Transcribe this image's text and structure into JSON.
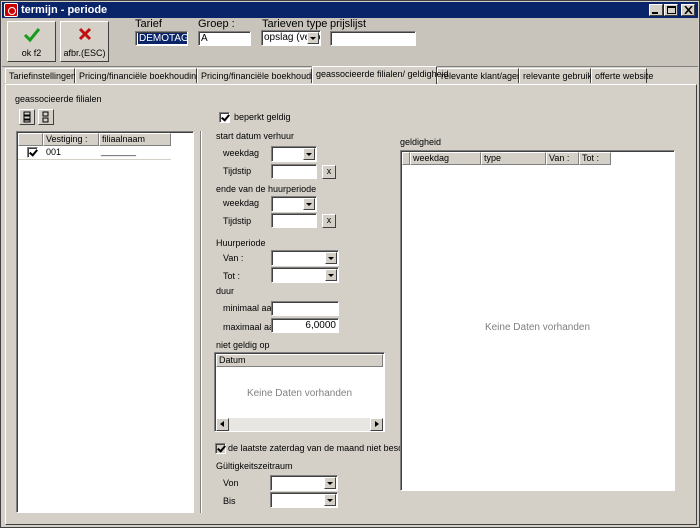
{
  "window": {
    "title": "termijn - periode"
  },
  "toolbar": {
    "ok_label": "ok f2",
    "cancel_label": "afbr.(ESC)"
  },
  "header": {
    "tarief_label": "Tarief",
    "tarief_value": "DEMOTAG",
    "groep_label": "Groep :",
    "groep_value": "A",
    "tarieven_type_label": "Tarieven type",
    "tarieven_type_value": "opslag (verko",
    "prijslijst_label": "prijslijst",
    "prijslijst_value": ""
  },
  "tabs": [
    {
      "label": "Tariefinstellingen"
    },
    {
      "label": "Pricing/financiële boekhouding I"
    },
    {
      "label": "Pricing/financiële boekhouding II"
    },
    {
      "label": "geassocieerde filialen/ geldigheid"
    },
    {
      "label": "relevante klant/agent"
    },
    {
      "label": "relevante gebruiker"
    },
    {
      "label": "offerte website"
    }
  ],
  "filialen": {
    "title": "geassocieerde filialen",
    "columns": [
      "Vestiging :",
      "filiaalnaam"
    ],
    "rows": [
      {
        "vestiging": "001",
        "naam": "_______"
      }
    ]
  },
  "form": {
    "beperkt_geldig": "beperkt geldig",
    "start_section": "start datum verhuur",
    "weekdag": "weekdag",
    "tijdstip": "Tijdstip",
    "x_label": "x",
    "ende_section": "ende van de huurperiode",
    "huurperiode": "Huurperiode",
    "van": "Van :",
    "tot": "Tot :",
    "duur": "duur",
    "minimaal": "minimaal aanta",
    "maximaal": "maximaal aant",
    "maximaal_value": "6,0000",
    "niet_geldig_op": "niet geldig op",
    "datum_col": "Datum",
    "no_data": "Keine Daten vorhanden",
    "laatste_zaterdag": "de laatste zaterdag van de maand niet beschik",
    "gueltigkeitszeitraum": "Gültigkeitszeitraum",
    "von": "Von",
    "bis": "Bis"
  },
  "geldigheid": {
    "title": "geldigheid",
    "columns": [
      "weekdag",
      "type",
      "Van :",
      "Tot :"
    ],
    "no_data": "Keine Daten vorhanden"
  },
  "colors": {
    "titlebar": "#0a246a",
    "face": "#d4d0c8",
    "selection": "#0a246a"
  },
  "icons": [
    "app-icon",
    "minimize-icon",
    "maximize-icon",
    "close-icon",
    "check-icon",
    "cancel-x-icon",
    "grid-add-icon",
    "grid-remove-icon",
    "checkbox-checked-icon"
  ]
}
